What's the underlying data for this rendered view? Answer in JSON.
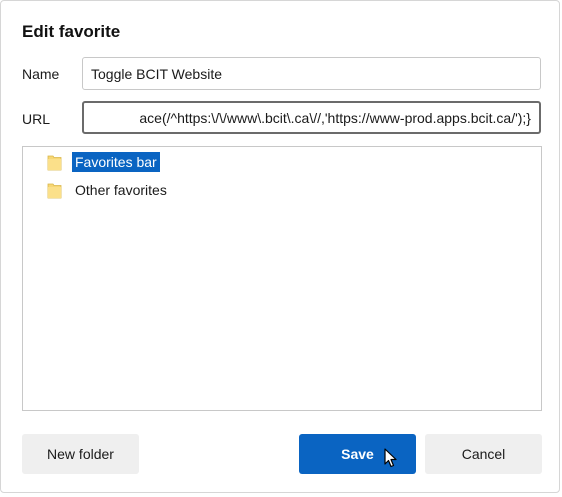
{
  "dialog": {
    "title": "Edit favorite",
    "name_label": "Name",
    "name_value": "Toggle BCIT Website",
    "url_label": "URL",
    "url_value": "ace(/^https:\\/\\/www\\.bcit\\.ca\\//,'https://www-prod.apps.bcit.ca/');}"
  },
  "folders": [
    {
      "label": "Favorites bar",
      "selected": true,
      "icon": "folder-icon"
    },
    {
      "label": "Other favorites",
      "selected": false,
      "icon": "folder-icon"
    }
  ],
  "buttons": {
    "new_folder": "New folder",
    "save": "Save",
    "cancel": "Cancel"
  },
  "colors": {
    "accent": "#0a64c2",
    "folder": "#f7d775"
  }
}
